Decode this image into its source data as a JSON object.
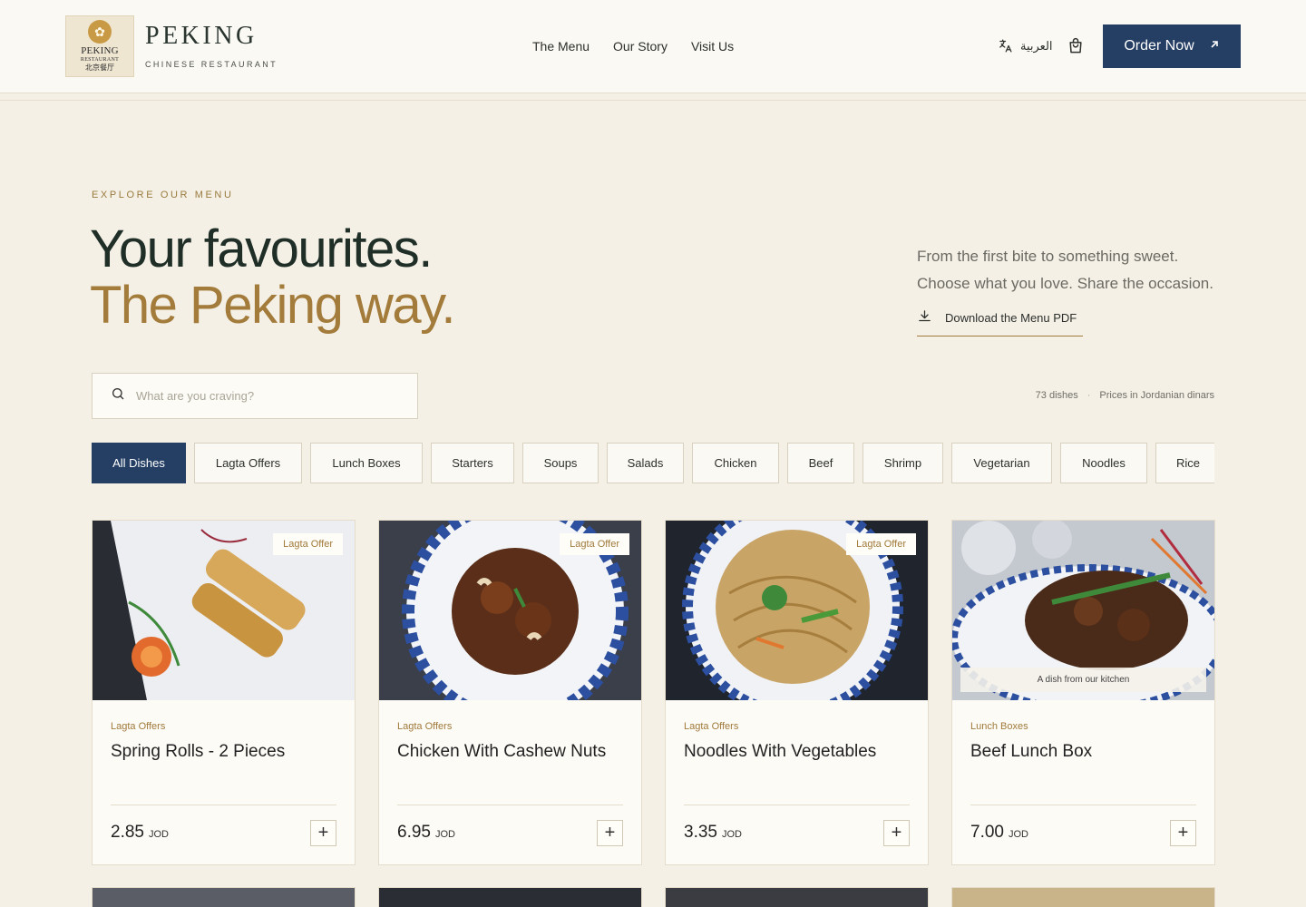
{
  "header": {
    "logo": {
      "line1": "PEKING",
      "line2": "RESTAURANT",
      "line3": "北京餐厅"
    },
    "brand_name": "PEKING",
    "brand_sub": "CHINESE RESTAURANT",
    "nav": [
      "The Menu",
      "Our Story",
      "Visit Us"
    ],
    "language": "العربية",
    "order_label": "Order Now"
  },
  "hero": {
    "eyebrow": "EXPLORE OUR MENU",
    "title_line1": "Your favourites.",
    "title_line2": "The Peking way.",
    "text_line1": "From the first bite to something sweet.",
    "text_line2": "Choose what you love. Share the occasion.",
    "pdf_label": "Download the Menu PDF"
  },
  "search": {
    "placeholder": "What are you craving?"
  },
  "meta": {
    "count": "73 dishes",
    "currency_note": "Prices in Jordanian dinars"
  },
  "tabs": [
    "All Dishes",
    "Lagta Offers",
    "Lunch Boxes",
    "Starters",
    "Soups",
    "Salads",
    "Chicken",
    "Beef",
    "Shrimp",
    "Vegetarian",
    "Noodles",
    "Rice"
  ],
  "cards": [
    {
      "category": "Lagta Offers",
      "title": "Spring Rolls - 2 Pieces",
      "price": "2.85",
      "currency": "JOD",
      "badge": "Lagta Offer"
    },
    {
      "category": "Lagta Offers",
      "title": "Chicken With Cashew Nuts",
      "price": "6.95",
      "currency": "JOD",
      "badge": "Lagta Offer"
    },
    {
      "category": "Lagta Offers",
      "title": "Noodles With Vegetables",
      "price": "3.35",
      "currency": "JOD",
      "badge": "Lagta Offer"
    },
    {
      "category": "Lunch Boxes",
      "title": "Beef Lunch Box",
      "price": "7.00",
      "currency": "JOD",
      "caption": "A dish from our kitchen"
    }
  ],
  "colors": {
    "accent": "#243e64",
    "gold": "#a37b3a",
    "background": "#f4f0e6"
  }
}
